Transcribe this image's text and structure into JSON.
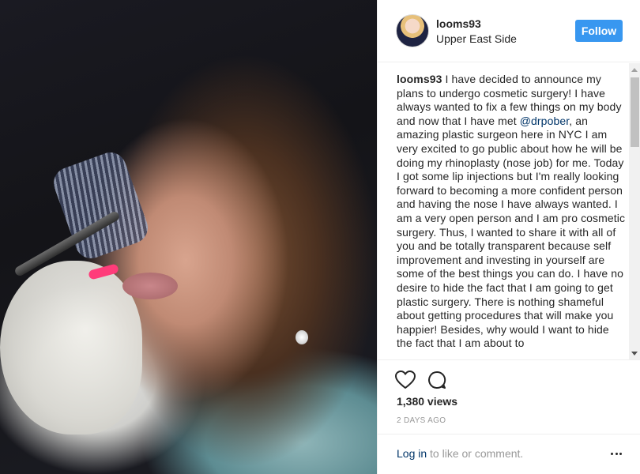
{
  "post": {
    "username": "looms93",
    "location": "Upper East Side",
    "follow_label": "Follow"
  },
  "caption": {
    "username": "looms93",
    "text_before_mention": " I have decided to announce my plans to undergo cosmetic surgery! I have always wanted to fix a few things on my body and now that I have met ",
    "mention": "@drpober",
    "text_after_mention": ", an amazing plastic surgeon here in NYC I am very excited to go public about how he will be doing my rhinoplasty (nose job) for me. Today I got some lip injections but I'm really looking forward to becoming a more confident person and having the nose I have always wanted. I am a very open person and I am pro cosmetic surgery. Thus, I wanted to share it with all of you and be totally transparent because self improvement and investing in yourself are some of the best things you can do. I have no desire to hide the fact that I am going to get plastic surgery. There is nothing shameful about getting procedures that will make you happier! Besides, why would I want to hide the fact that I am about to"
  },
  "actions": {
    "like_icon": "heart-icon",
    "comment_icon": "speech-bubble-icon"
  },
  "stats": {
    "views": "1,380 views",
    "timestamp": "2 DAYS AGO"
  },
  "footer": {
    "login_link": "Log in",
    "login_rest": " to like or comment.",
    "more_icon": "more-options-icon"
  },
  "colors": {
    "accent": "#3897f0",
    "link": "#003569",
    "muted": "#999999"
  }
}
